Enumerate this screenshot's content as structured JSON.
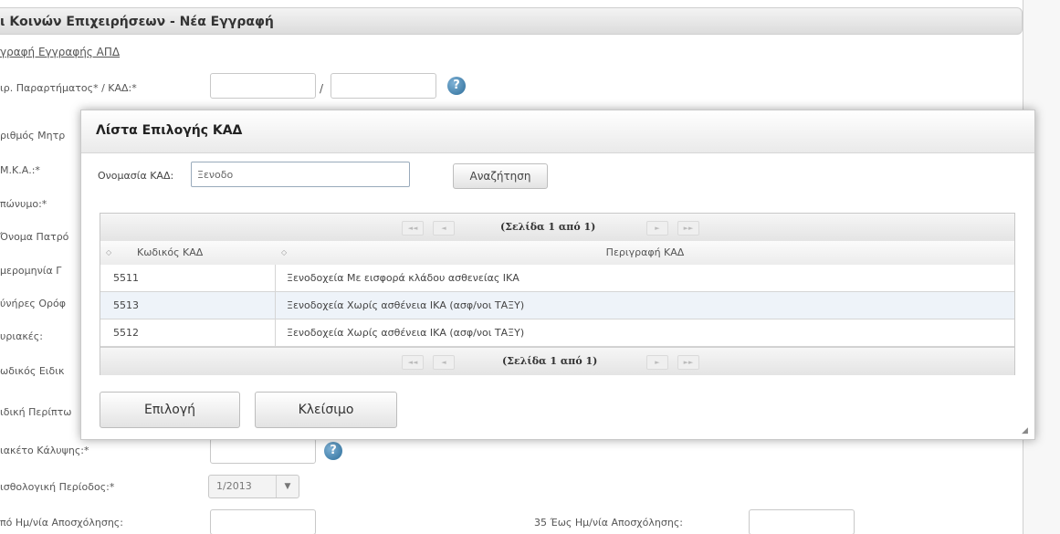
{
  "page": {
    "header_title": "ι Κοινών Επιχειρήσεων - Νέα Εγγραφή",
    "link": "γραφή Εγγραφής ΑΠΔ",
    "labels": [
      "ιρ. Παραρτήματος* / ΚΑΔ:*",
      "ριθμός Μητρ",
      "Μ.Κ.Α.:*",
      "πώνυμο:*",
      "Όνομα Πατρό",
      "μερομηνία Γ",
      "ύνήρες Ορόφ",
      "υριακές:",
      "ωδικός Ειδικ",
      "ιδική Περίπτω",
      "ιακέτο Κάλυψης:*",
      "ισθολογική Περίοδος:*",
      "πό Ημ/νία Αποσχόλησης:"
    ],
    "slash": "/",
    "help_glyph": "?",
    "period_value": "1/2013",
    "right_label": "35 Έως Ημ/νία Αποσχόλησης:"
  },
  "modal": {
    "title": "Λίστα Επιλογής ΚΑΔ",
    "search_label": "Ονομασία ΚΑΔ:",
    "search_value": "Ξενοδο",
    "search_button": "Αναζήτηση",
    "pager_top": "(Σελίδα 1 από 1)",
    "pager_bottom": "(Σελίδα 1 από 1)",
    "columns": [
      "Κωδικός ΚΑΔ",
      "Περιγραφή ΚΑΔ"
    ],
    "rows": [
      {
        "code": "5511",
        "description": "Ξενοδοχεία Με εισφορά κλάδου ασθενείας ΙΚΑ"
      },
      {
        "code": "5513",
        "description": "Ξενοδοχεία Χωρίς ασθένεια ΙΚΑ (ασφ/νοι ΤΑΞΥ)"
      },
      {
        "code": "5512",
        "description": "Ξενοδοχεία Χωρίς ασθένεια ΙΚΑ (ασφ/νοι ΤΑΞΥ)"
      }
    ],
    "selected_row": 1,
    "select_button": "Επιλογή",
    "close_button": "Κλείσιμο"
  }
}
